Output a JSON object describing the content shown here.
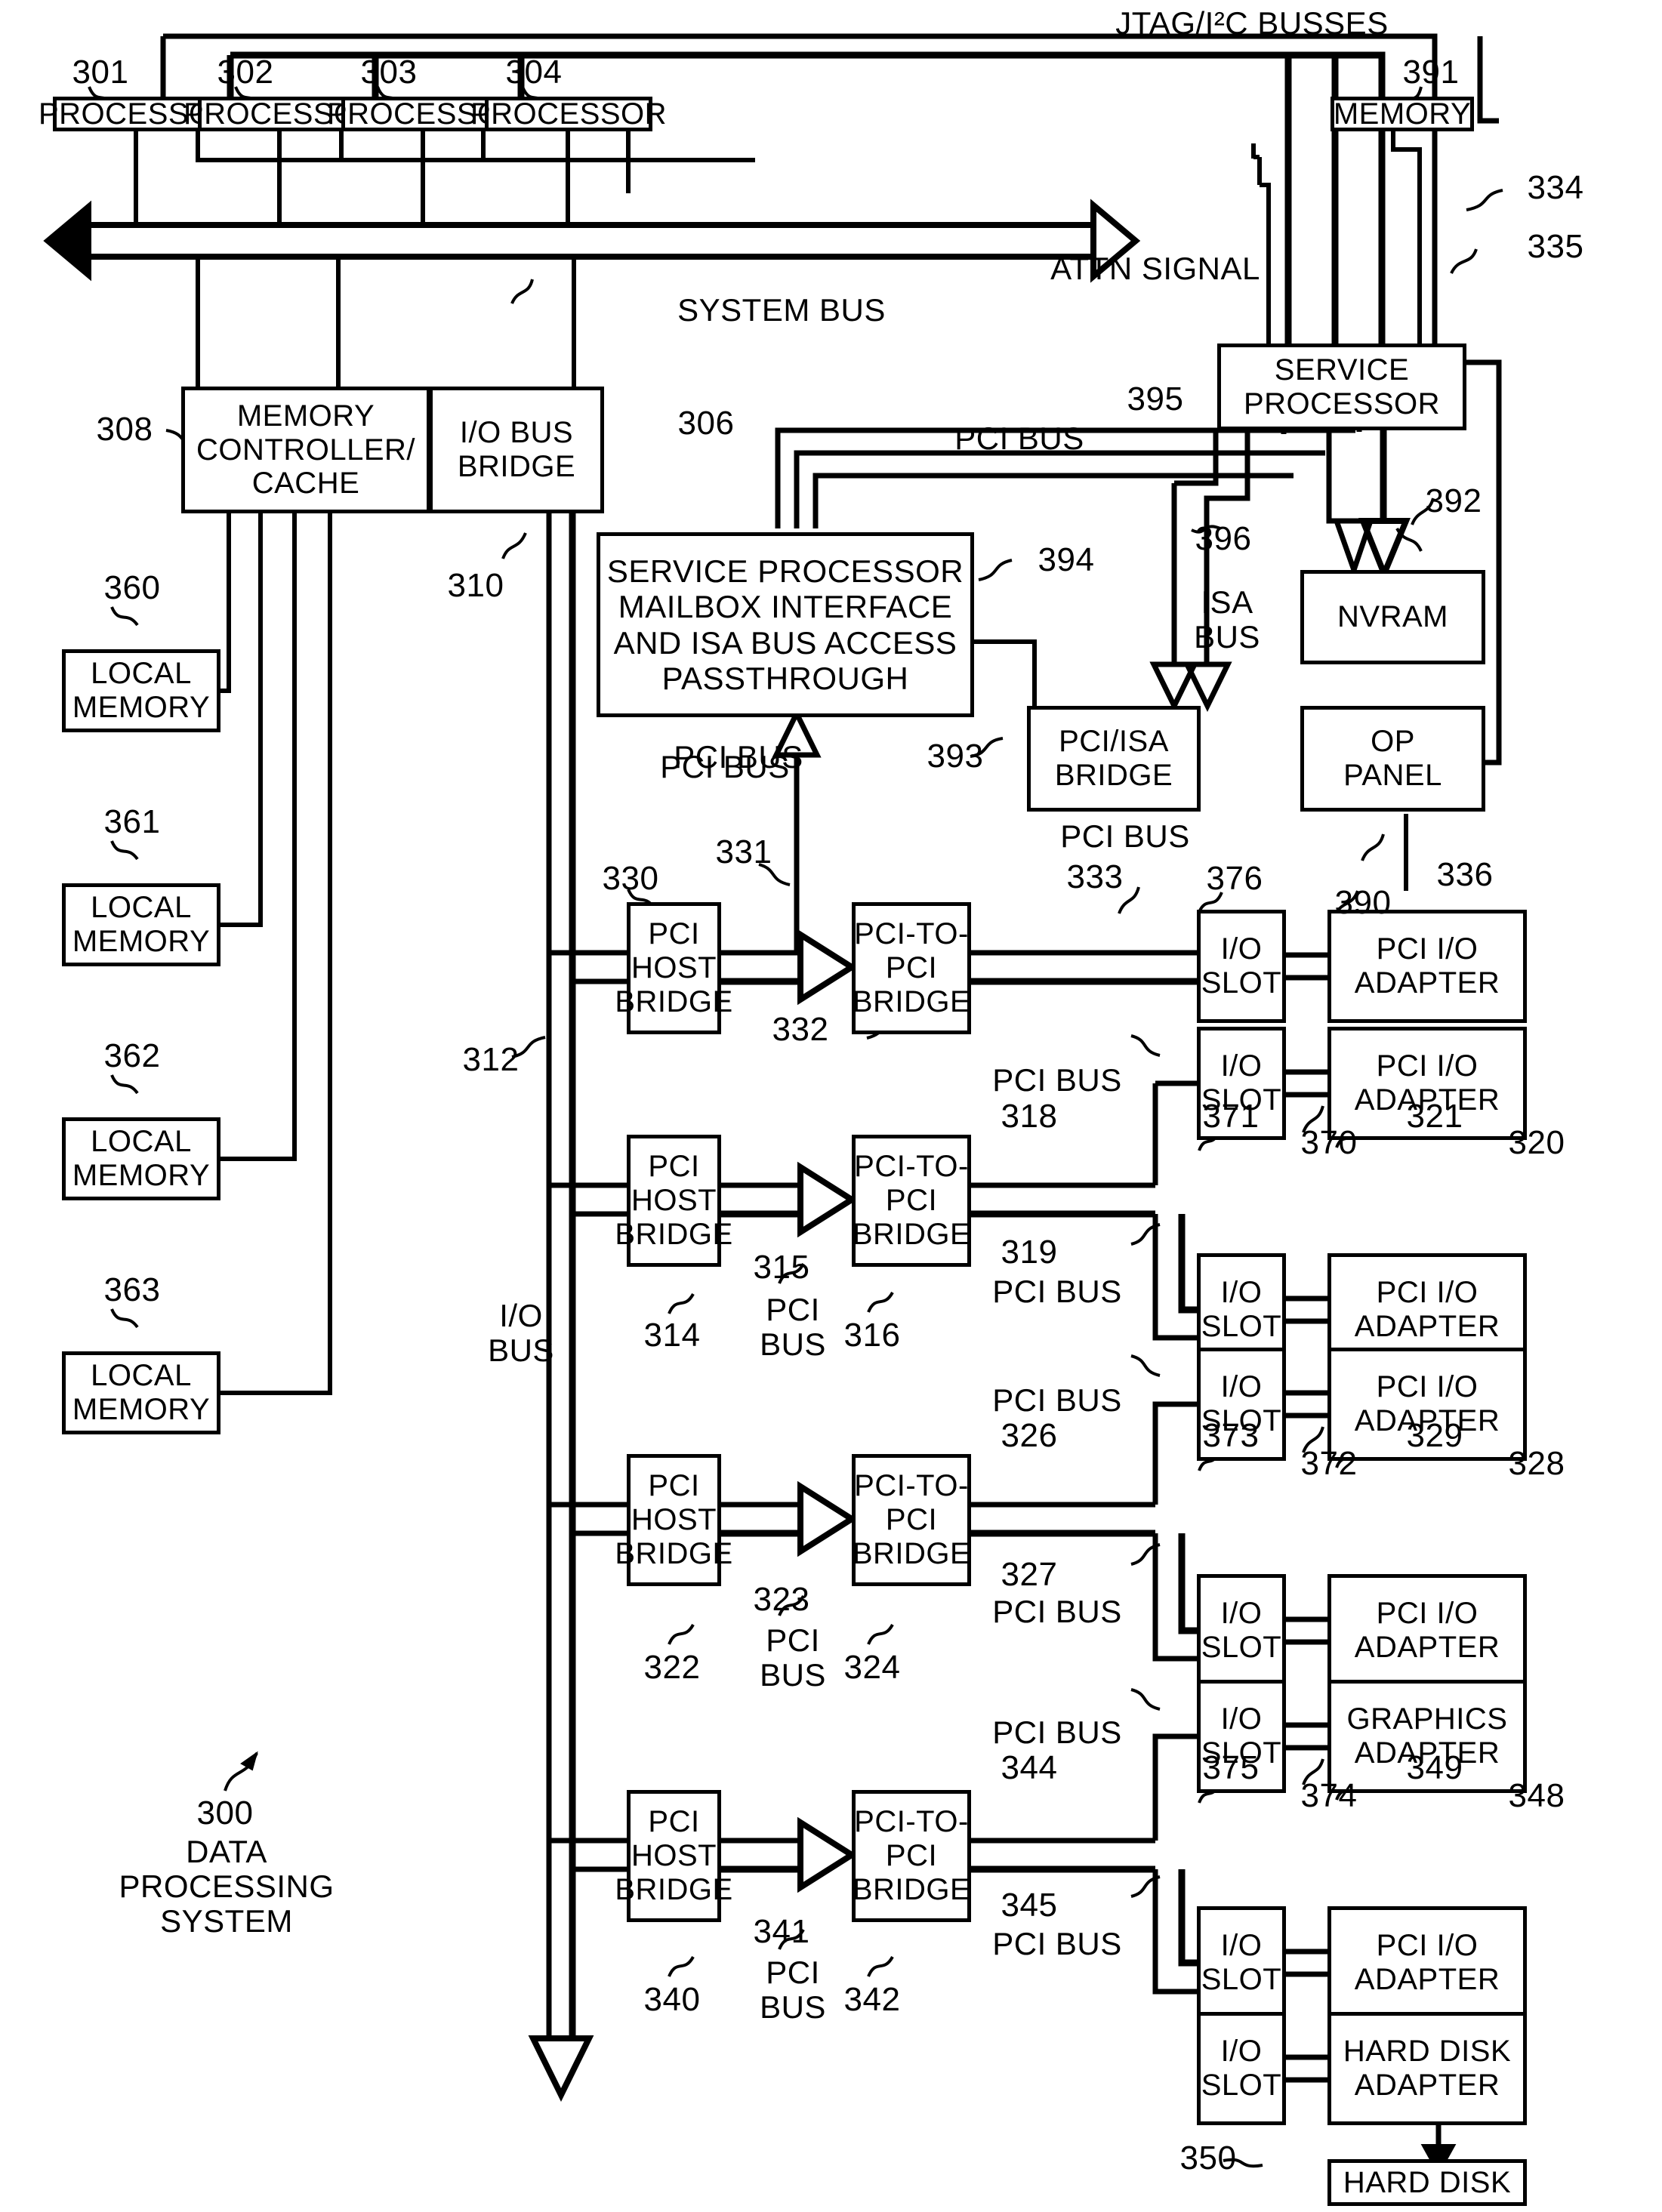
{
  "figure": {
    "title": "DATA PROCESSING SYSTEM",
    "figure_number": "300",
    "top_bus_label": "JTAG/I²C BUSSES",
    "system_bus_label": "SYSTEM BUS",
    "attn_signal_label": "ATTN SIGNAL",
    "io_bus_label": "I/O\nBUS",
    "isa_bus_label": "ISA\nBUS",
    "pci_bus_label": "PCI BUS",
    "pci_bus_two_line": "PCI\nBUS"
  },
  "boxes": {
    "processor": "PROCESSOR",
    "memory": "MEMORY",
    "service_processor": "SERVICE\nPROCESSOR",
    "memory_controller_cache": "MEMORY\nCONTROLLER/\nCACHE",
    "io_bus_bridge": "I/O BUS\nBRIDGE",
    "sp_mailbox": "SERVICE PROCESSOR\nMAILBOX INTERFACE\nAND ISA BUS ACCESS\nPASSTHROUGH",
    "pci_isa_bridge": "PCI/ISA\nBRIDGE",
    "nvram": "NVRAM",
    "op_panel": "OP\nPANEL",
    "local_memory": "LOCAL\nMEMORY",
    "pci_host_bridge": "PCI\nHOST\nBRIDGE",
    "pci_to_pci_bridge": "PCI-TO-\nPCI\nBRIDGE",
    "io_slot": "I/O\nSLOT",
    "pci_io_adapter": "PCI I/O\nADAPTER",
    "graphics_adapter": "GRAPHICS\nADAPTER",
    "hard_disk_adapter": "HARD DISK\nADAPTER",
    "hard_disk": "HARD DISK"
  },
  "processors": [
    {
      "ref": "301",
      "label": "PROCESSOR"
    },
    {
      "ref": "302",
      "label": "PROCESSOR"
    },
    {
      "ref": "303",
      "label": "PROCESSOR"
    },
    {
      "ref": "304",
      "label": "PROCESSOR"
    }
  ],
  "local_memories": [
    {
      "ref": "360",
      "label": "LOCAL\nMEMORY"
    },
    {
      "ref": "361",
      "label": "LOCAL\nMEMORY"
    },
    {
      "ref": "362",
      "label": "LOCAL\nMEMORY"
    },
    {
      "ref": "363",
      "label": "LOCAL\nMEMORY"
    }
  ],
  "refs": {
    "r300": "300",
    "r301": "301",
    "r302": "302",
    "r303": "303",
    "r304": "304",
    "r306": "306",
    "r308": "308",
    "r310": "310",
    "r312": "312",
    "r314": "314",
    "r315": "315",
    "r316": "316",
    "r318": "318",
    "r319": "319",
    "r320": "320",
    "r321": "321",
    "r322": "322",
    "r323": "323",
    "r324": "324",
    "r326": "326",
    "r327": "327",
    "r328": "328",
    "r329": "329",
    "r330": "330",
    "r331": "331",
    "r332": "332",
    "r333": "333",
    "r334": "334",
    "r335": "335",
    "r336": "336",
    "r340": "340",
    "r341": "341",
    "r342": "342",
    "r344": "344",
    "r345": "345",
    "r348": "348",
    "r349": "349",
    "r350": "350",
    "r360": "360",
    "r361": "361",
    "r362": "362",
    "r363": "363",
    "r370": "370",
    "r371": "371",
    "r372": "372",
    "r373": "373",
    "r374": "374",
    "r375": "375",
    "r376": "376",
    "r390": "390",
    "r391": "391",
    "r392": "392",
    "r393": "393",
    "r394": "394",
    "r395": "395",
    "r396": "396"
  }
}
